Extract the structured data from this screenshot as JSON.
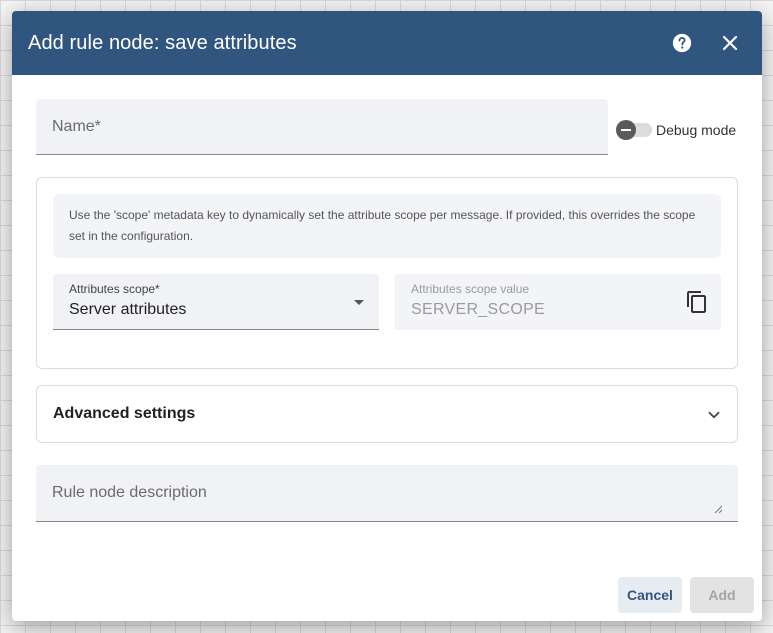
{
  "dialog": {
    "title": "Add rule node: save attributes",
    "help_icon": "help-circle-icon",
    "close_icon": "close-icon"
  },
  "name_field": {
    "label": "Name*",
    "value": ""
  },
  "debug_mode": {
    "label": "Debug mode",
    "enabled": false
  },
  "configuration": {
    "info_text": "Use the 'scope' metadata key to dynamically set the attribute scope per message. If provided, this overrides the scope set in the configuration.",
    "attributes_scope": {
      "label": "Attributes scope*",
      "selected": "Server attributes"
    },
    "attributes_scope_value": {
      "label": "Attributes scope value",
      "value": "SERVER_SCOPE"
    }
  },
  "advanced_settings": {
    "label": "Advanced settings",
    "expanded": false
  },
  "description_field": {
    "label": "Rule node description",
    "value": ""
  },
  "actions": {
    "cancel_label": "Cancel",
    "add_label": "Add",
    "add_enabled": false
  },
  "colors": {
    "header": "#305680",
    "primary_text": "#305680"
  }
}
